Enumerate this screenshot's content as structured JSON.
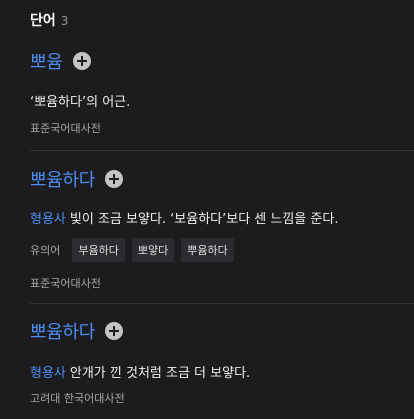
{
  "header": {
    "title": "단어",
    "count": "3"
  },
  "entries": [
    {
      "word": "뽀윰",
      "pos": "",
      "definition": "‘뽀윰하다’의 어근.",
      "synonyms_label": "",
      "synonyms": [],
      "source": "표준국어대사전"
    },
    {
      "word": "뽀윰하다",
      "pos": "형용사",
      "definition": "빛이 조금 보얗다. ‘보윰하다’보다 센 느낌을 준다.",
      "synonyms_label": "유의어",
      "synonyms": [
        "부윰하다",
        "뽀얗다",
        "뿌윰하다"
      ],
      "source": "표준국어대사전"
    },
    {
      "word": "뽀윰하다",
      "pos": "형용사",
      "definition": "안개가 낀 것처럼 조금 더 보얗다.",
      "synonyms_label": "",
      "synonyms": [],
      "source": "고려대 한국어대사전"
    }
  ],
  "colors": {
    "accent": "#4b8df0",
    "background": "#1c1c1e",
    "divider": "#353538"
  }
}
